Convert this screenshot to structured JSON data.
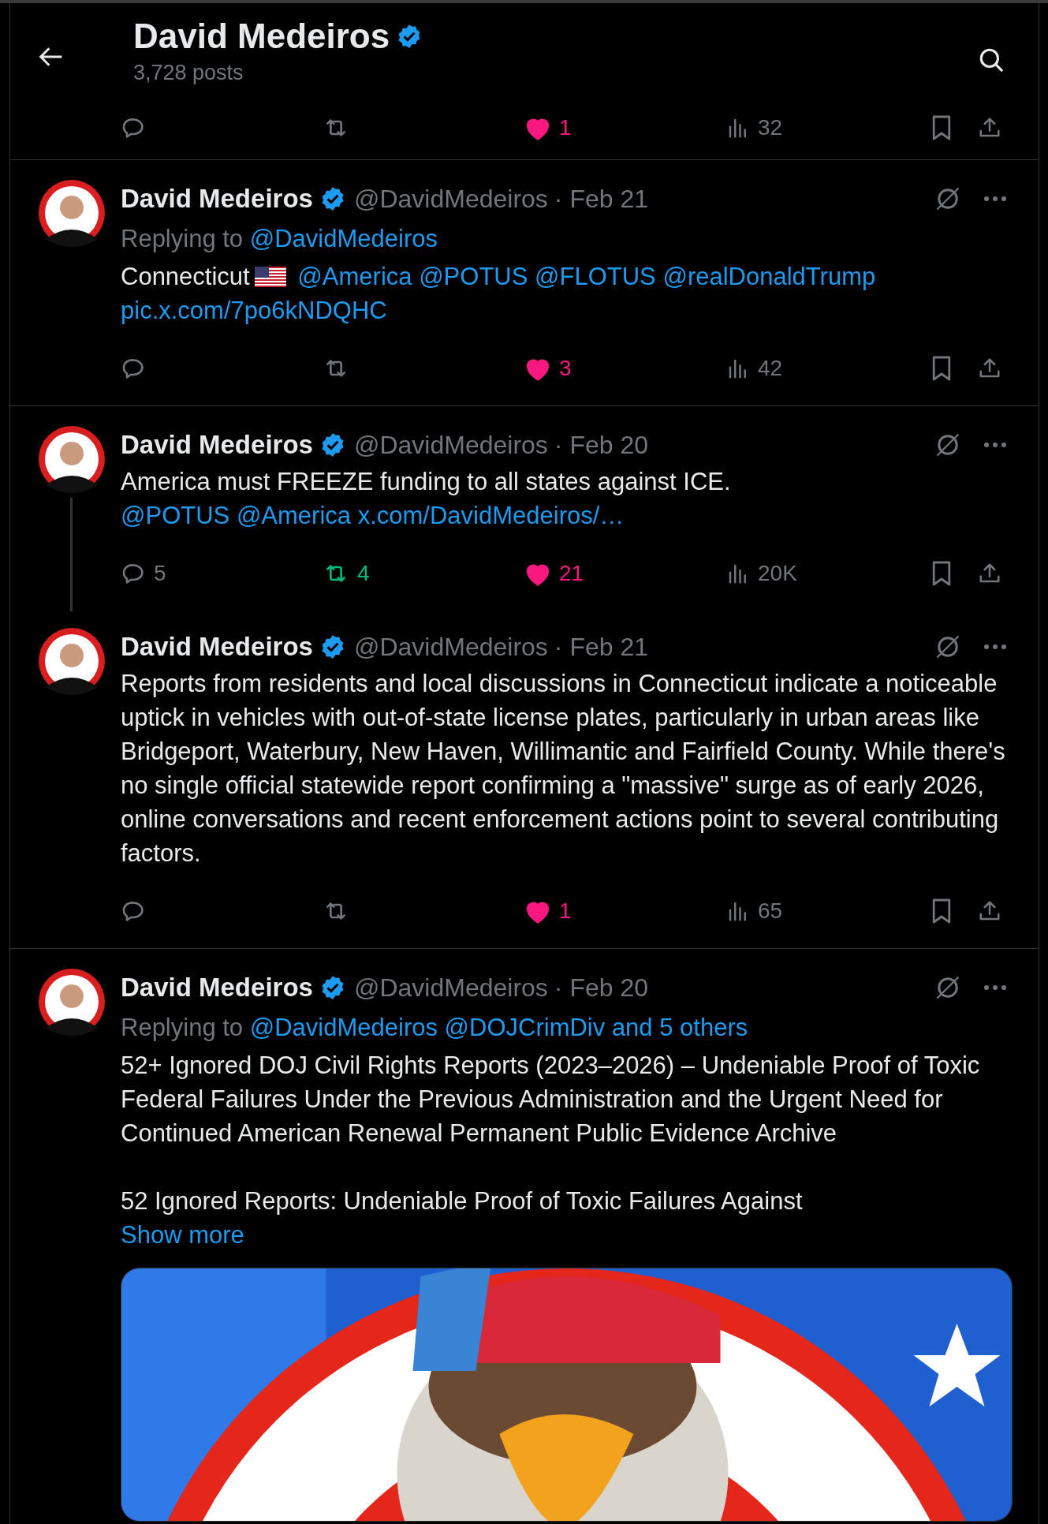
{
  "header": {
    "title": "David Medeiros",
    "verified": true,
    "posts": "3,728 posts"
  },
  "top_actions": {
    "reposted": false,
    "likes": "1",
    "liked": true,
    "views": "32"
  },
  "tweets": [
    {
      "name": "David Medeiros",
      "verified": true,
      "handle": "@DavidMedeiros",
      "date": "· Feb 21",
      "connected_below": false,
      "replying_label": "Replying to",
      "replying_links": [
        "@DavidMedeiros"
      ],
      "paragraphs": [
        [
          {
            "kind": "text",
            "text": "Connecticut"
          },
          {
            "kind": "flag"
          },
          {
            "kind": "link",
            "text": "@America"
          },
          {
            "kind": "link",
            "text": "@POTUS"
          },
          {
            "kind": "link",
            "text": "@FLOTUS"
          },
          {
            "kind": "link",
            "text": "@realDonaldTrump"
          },
          {
            "kind": "link",
            "text": "pic.x.com/7po6kNDQHC"
          }
        ]
      ],
      "actions": {
        "reposted": false,
        "likes": "3",
        "liked": true,
        "views": "42"
      }
    },
    {
      "name": "David Medeiros",
      "verified": true,
      "handle": "@DavidMedeiros",
      "date": "· Feb 20",
      "connected_below": true,
      "paragraphs": [
        [
          {
            "kind": "text",
            "text": "America must FREEZE funding to all states against ICE."
          }
        ],
        [
          {
            "kind": "link",
            "text": "@POTUS"
          },
          {
            "kind": "link",
            "text": "@America"
          },
          {
            "kind": "link",
            "text": "x.com/DavidMedeiros/…"
          }
        ]
      ],
      "actions": {
        "replies": "5",
        "reposts": "4",
        "reposted": true,
        "likes": "21",
        "liked": true,
        "views": "20K"
      }
    },
    {
      "name": "David Medeiros",
      "verified": true,
      "handle": "@DavidMedeiros",
      "date": "· Feb 21",
      "connected_below": false,
      "paragraphs": [
        [
          {
            "kind": "text",
            "text": "Reports from residents and local discussions in Connecticut indicate a noticeable uptick in vehicles with out-of-state license plates, particularly in urban areas like Bridgeport, Waterbury, New Haven, Willimantic and Fairfield County. While there's no single official statewide report confirming a \"massive\" surge as of early 2026, online conversations and recent enforcement actions point to several contributing factors."
          }
        ]
      ],
      "actions": {
        "reposted": false,
        "likes": "1",
        "liked": true,
        "views": "65"
      }
    },
    {
      "name": "David Medeiros",
      "verified": true,
      "handle": "@DavidMedeiros",
      "date": "· Feb 20",
      "connected_below": false,
      "replying_label": "Replying to",
      "replying_links": [
        "@DavidMedeiros",
        "@DOJCrimDiv",
        "and 5 others"
      ],
      "paragraphs": [
        [
          {
            "kind": "text",
            "text": "52+ Ignored DOJ Civil Rights Reports (2023–2026) – Undeniable Proof of Toxic Federal Failures Under the Previous Administration and the Urgent Need for Continued American Renewal Permanent Public Evidence Archive"
          }
        ],
        [
          {
            "kind": "text",
            "text": "52 Ignored Reports: Undeniable Proof of Toxic Failures Against"
          }
        ]
      ],
      "show_more": "Show more",
      "media": {
        "kind": "picture"
      }
    }
  ]
}
